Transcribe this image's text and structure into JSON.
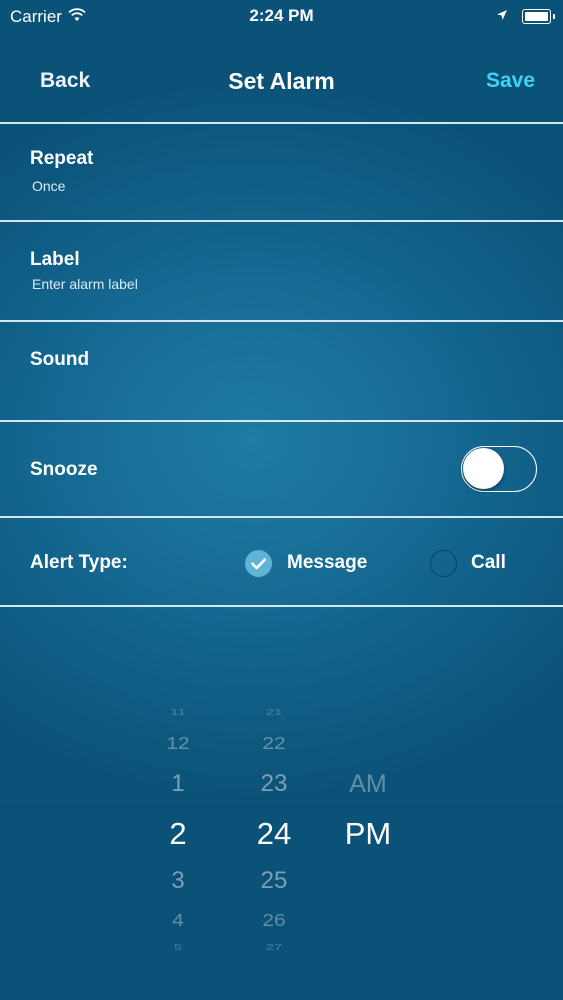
{
  "status_bar": {
    "carrier": "Carrier",
    "time": "2:24 PM",
    "icons": [
      "wifi-icon",
      "location-arrow-icon",
      "battery-icon"
    ]
  },
  "nav": {
    "back_label": "Back",
    "title": "Set Alarm",
    "save_label": "Save"
  },
  "settings": {
    "repeat": {
      "label": "Repeat",
      "value": "Once"
    },
    "label": {
      "label": "Label",
      "placeholder": "Enter alarm label"
    },
    "sound": {
      "label": "Sound"
    },
    "snooze": {
      "label": "Snooze",
      "enabled": false
    }
  },
  "alert_type": {
    "label": "Alert Type:",
    "options": [
      {
        "label": "Message",
        "selected": true
      },
      {
        "label": "Call",
        "selected": false
      }
    ]
  },
  "picker": {
    "hours": [
      "11",
      "12",
      "1",
      "2",
      "3",
      "4",
      "5"
    ],
    "minutes": [
      "21",
      "22",
      "23",
      "24",
      "25",
      "26",
      "27"
    ],
    "ampm": [
      "AM",
      "PM"
    ],
    "selected": {
      "hour": "2",
      "minute": "24",
      "period": "PM"
    }
  },
  "colors": {
    "background": "#166a93",
    "accent": "#3fd2f5",
    "divider": "#d4e6ef",
    "radio_checked": "#5fb4d6"
  }
}
